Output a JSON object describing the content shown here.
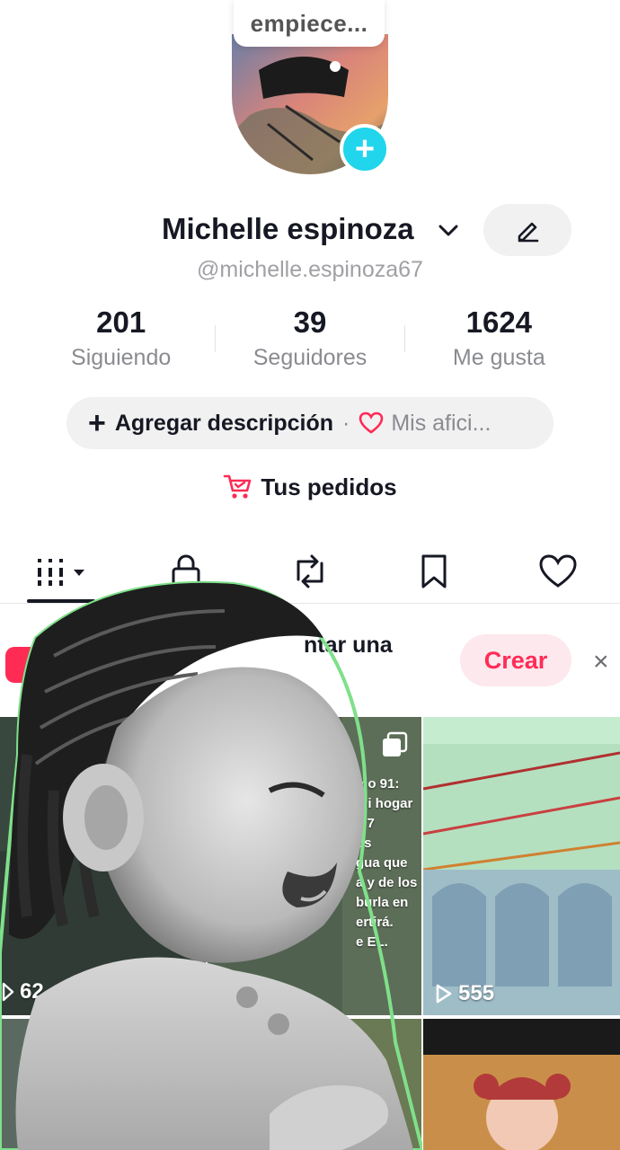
{
  "note": {
    "text": "empiece..."
  },
  "profile": {
    "name": "Michelle espinoza",
    "handle": "@michelle.espinoza67"
  },
  "stats": [
    {
      "value": "201",
      "label": "Siguiendo"
    },
    {
      "value": "39",
      "label": "Seguidores"
    },
    {
      "value": "1624",
      "label": "Me gusta"
    }
  ],
  "bio": {
    "add_label": "Agregar descripción",
    "separator": "·",
    "hobbies_label": "Mis afici..."
  },
  "orders": {
    "label": "Tus pedidos"
  },
  "tabs": [
    "videos",
    "private",
    "reposts",
    "favorites",
    "liked"
  ],
  "promo": {
    "text": "ntar una",
    "create_label": "Crear",
    "close": "×"
  },
  "grid": {
    "overlay_lines": [
      "mo 91:",
      "mi hogar",
      "s 7",
      "os",
      "gua que",
      "a y de los",
      "burla en",
      "ertirá.",
      "e EL."
    ],
    "views_left": "62",
    "views_right": "555"
  },
  "colors": {
    "accent_pink": "#fe2c55",
    "accent_cyan": "#20d5ec",
    "text_primary": "#161823",
    "text_secondary": "#8a8b91"
  }
}
